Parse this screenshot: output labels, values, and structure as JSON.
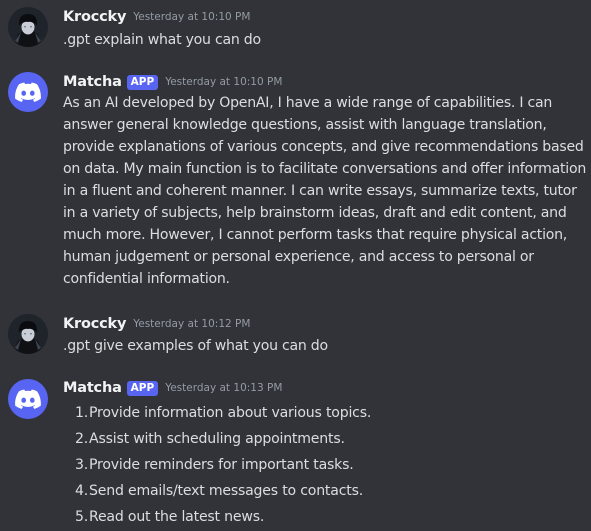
{
  "messages": [
    {
      "author": "Kroccky",
      "timestamp": "Yesterday at 10:10 PM",
      "text": ".gpt explain what you can do",
      "avatar_icon": "user-avatar"
    },
    {
      "author": "Matcha",
      "badge": "APP",
      "timestamp": "Yesterday at 10:10 PM",
      "text": "As an AI developed by OpenAI, I have a wide range of capabilities. I can answer general knowledge questions, assist with language translation, provide explanations of various concepts, and give recommendations based on data. My main function is to facilitate conversations and offer information in a fluent and coherent manner. I can write essays, summarize texts, tutor in a variety of subjects, help brainstorm ideas, draft and edit content, and much more. However, I cannot perform tasks that require physical action, human judgement or personal experience, and access to personal or confidential information.",
      "avatar_icon": "discord-logo-icon"
    },
    {
      "author": "Kroccky",
      "timestamp": "Yesterday at 10:12 PM",
      "text": ".gpt give examples of what you can do",
      "avatar_icon": "user-avatar"
    },
    {
      "author": "Matcha",
      "badge": "APP",
      "timestamp": "Yesterday at 10:13 PM",
      "list": [
        {
          "num": "1.",
          "text": "Provide information about various topics."
        },
        {
          "num": "2.",
          "text": "Assist with scheduling appointments."
        },
        {
          "num": "3.",
          "text": "Provide reminders for important tasks."
        },
        {
          "num": "4.",
          "text": "Send emails/text messages to contacts."
        },
        {
          "num": "5.",
          "text": "Read out the latest news."
        }
      ],
      "avatar_icon": "discord-logo-icon"
    }
  ],
  "colors": {
    "background": "#313338",
    "blurple": "#5865f2",
    "username": "#f2f3f5",
    "text": "#dbdee1",
    "timestamp": "#949ba4"
  }
}
